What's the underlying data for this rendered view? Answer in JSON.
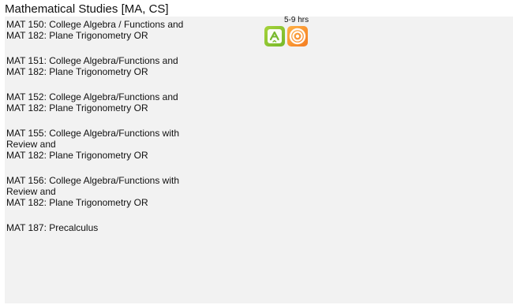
{
  "section": {
    "title": "Mathematical Studies [MA, CS]"
  },
  "hours": "5-9 hrs",
  "icons": [
    {
      "name": "green-a-icon",
      "color": "#8bc53f"
    },
    {
      "name": "orange-target-icon",
      "color": "#f58220"
    }
  ],
  "courses": [
    {
      "lines": [
        "MAT 150: College Algebra / Functions and",
        "MAT 182: Plane Trigonometry OR"
      ]
    },
    {
      "lines": [
        "MAT 151: College Algebra/Functions and",
        "MAT 182: Plane Trigonometry OR"
      ]
    },
    {
      "lines": [
        "MAT 152: College Algebra/Functions and",
        "MAT 182: Plane Trigonometry OR"
      ]
    },
    {
      "lines": [
        "MAT 155: College Algebra/Functions with",
        "Review and",
        "MAT 182: Plane Trigonometry OR"
      ]
    },
    {
      "lines": [
        "MAT 156: College Algebra/Functions with",
        "Review and",
        "MAT 182: Plane Trigonometry OR"
      ]
    },
    {
      "lines": [
        "MAT 187: Precalculus"
      ]
    }
  ]
}
